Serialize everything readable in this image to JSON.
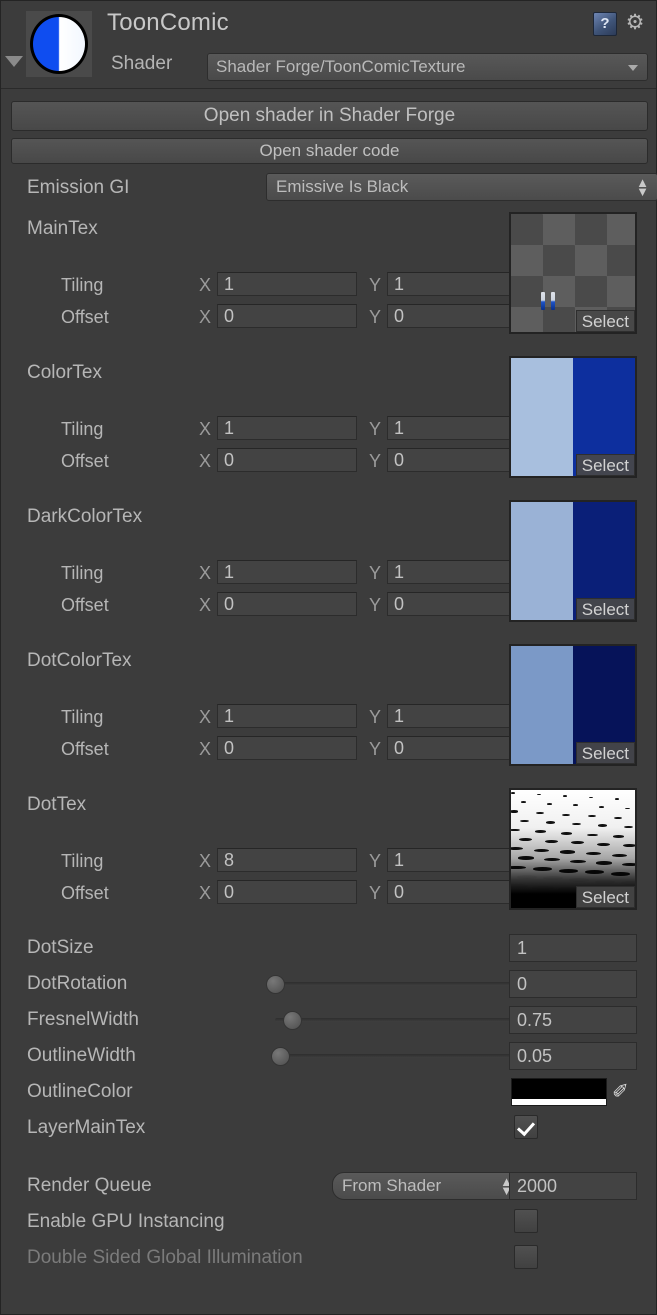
{
  "header": {
    "material_name": "ToonComic",
    "shader_label": "Shader",
    "shader_value": "Shader Forge/ToonComicTexture",
    "help_icon": "help-book-icon",
    "help_glyph": "?",
    "gear_icon": "gear-icon",
    "gear_glyph": "⚙",
    "foldout_icon": "foldout-triangle-icon",
    "preview_icon": "material-preview-sphere"
  },
  "buttons": {
    "open_in_shader_forge": "Open shader in Shader Forge",
    "open_shader_code": "Open shader code"
  },
  "emission": {
    "label": "Emission GI",
    "value": "Emissive Is Black"
  },
  "labels": {
    "tiling": "Tiling",
    "offset": "Offset",
    "axis_x": "X",
    "axis_y": "Y",
    "select": "Select"
  },
  "textures": [
    {
      "name": "MainTex",
      "tiling_x": "1",
      "tiling_y": "1",
      "offset_x": "0",
      "offset_y": "0",
      "thumb_kind": "checkerboard"
    },
    {
      "name": "ColorTex",
      "tiling_x": "1",
      "tiling_y": "1",
      "offset_x": "0",
      "offset_y": "0",
      "thumb_kind": "split",
      "color_left": "#a8bfde",
      "color_right": "#0d2f9e"
    },
    {
      "name": "DarkColorTex",
      "tiling_x": "1",
      "tiling_y": "1",
      "offset_x": "0",
      "offset_y": "0",
      "thumb_kind": "split",
      "color_left": "#9ab2d6",
      "color_right": "#0a1f78"
    },
    {
      "name": "DotColorTex",
      "tiling_x": "1",
      "tiling_y": "1",
      "offset_x": "0",
      "offset_y": "0",
      "thumb_kind": "split",
      "color_left": "#7b99c7",
      "color_right": "#061359"
    },
    {
      "name": "DotTex",
      "tiling_x": "8",
      "tiling_y": "1",
      "offset_x": "0",
      "offset_y": "0",
      "thumb_kind": "halftone"
    }
  ],
  "properties": [
    {
      "label": "DotSize",
      "value": "1",
      "slider": false
    },
    {
      "label": "DotRotation",
      "value": "0",
      "slider": true,
      "percent": 0
    },
    {
      "label": "FresnelWidth",
      "value": "0.75",
      "slider": true,
      "percent": 7
    },
    {
      "label": "OutlineWidth",
      "value": "0.05",
      "slider": true,
      "percent": 2
    }
  ],
  "outline_color": {
    "label": "OutlineColor",
    "swatch_color": "#000000",
    "alpha_color": "#ffffff",
    "eyedropper_icon": "eyedropper-icon",
    "eyedropper_glyph": "✐"
  },
  "layer_main_tex": {
    "label": "LayerMainTex",
    "checked": true
  },
  "render_queue": {
    "label": "Render Queue",
    "mode": "From Shader",
    "value": "2000"
  },
  "gpu_instancing": {
    "label": "Enable GPU Instancing",
    "checked": false
  },
  "double_sided_gi": {
    "label": "Double Sided Global Illumination",
    "checked": false,
    "disabled": true
  }
}
